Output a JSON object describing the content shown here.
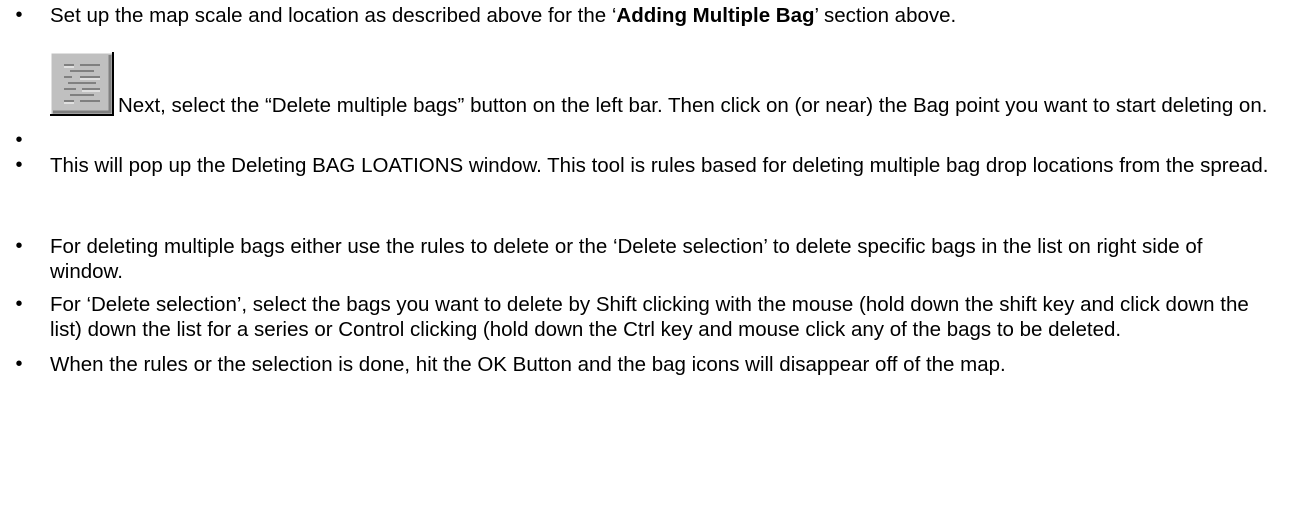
{
  "bullets": [
    {
      "pre": "Set up the map scale and location as described above for the ‘",
      "bold": "Adding Multiple Bag",
      "post": "’ section above."
    },
    {
      "icon": "delete-multiple-bags-tool-icon",
      "text": "Next, select the “Delete multiple bags” button on the left bar. Then click on (or near) the Bag point you want to start deleting on."
    },
    {
      "text": "This will pop up the Deleting BAG LOATIONS window. This tool is rules based for deleting multiple bag drop locations from the spread."
    },
    {
      "text": "For deleting multiple bags either use the rules to delete or the ‘Delete selection’ to delete specific bags in the list on right side of window."
    },
    {
      "text": "For ‘Delete selection’, select the bags you want to delete by Shift clicking with the mouse (hold down the shift key and click down the list) down the list for a series or Control clicking (hold down the Ctrl key and mouse click any of the bags to be deleted."
    },
    {
      "text": "When the rules or the selection is done, hit the OK Button and the bag icons will disappear off of the map."
    }
  ],
  "bullet_glyph": "•",
  "icon_colors": {
    "face": "#c0c0c0",
    "highlight": "#ffffff",
    "shadow": "#808080",
    "dark": "#000000",
    "mark": "#808080"
  }
}
